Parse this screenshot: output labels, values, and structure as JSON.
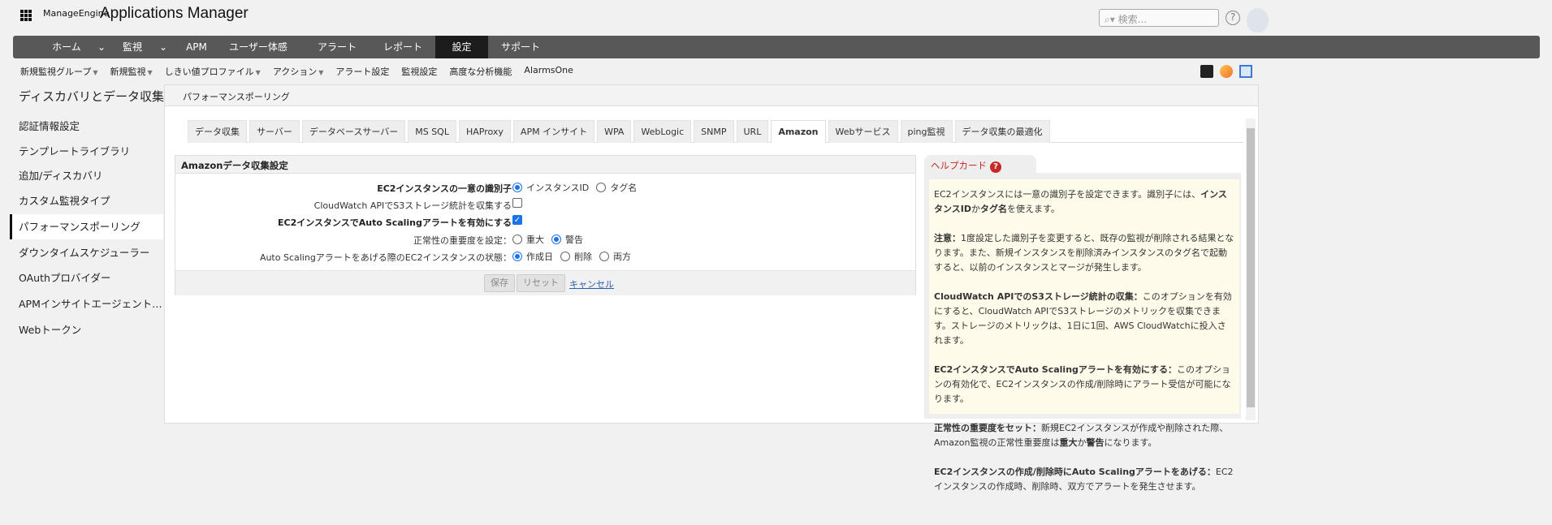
{
  "header": {
    "brand": "ManageEngine",
    "app_title": "Applications Manager",
    "search_placeholder": "検索...",
    "help": "?"
  },
  "nav": {
    "items": [
      {
        "label": "ホーム"
      },
      {
        "label": "監視"
      },
      {
        "label": "APM"
      },
      {
        "label": "ユーザー体感"
      },
      {
        "label": "アラート"
      },
      {
        "label": "レポート"
      },
      {
        "label": "設定",
        "active": true
      },
      {
        "label": "サポート"
      }
    ],
    "chevron": "⌄"
  },
  "subnav": [
    "新規監視グループ",
    "新規監視",
    "しきい値プロファイル",
    "アクション",
    "アラート設定",
    "監視設定",
    "高度な分析機能",
    "AlarmsOne"
  ],
  "sidebar": {
    "title": "ディスカバリとデータ収集",
    "items": [
      "認証情報設定",
      "テンプレートライブラリ",
      "追加/ディスカバリ",
      "カスタム監視タイプ",
      "パフォーマンスポーリング",
      "ダウンタイムスケジューラー",
      "OAuthプロバイダー",
      "APMインサイトエージェント設定...",
      "Webトークン"
    ],
    "active_index": 4
  },
  "main": {
    "title": "パフォーマンスポーリング",
    "tabs": [
      "データ収集",
      "サーバー",
      "データベースサーバー",
      "MS SQL",
      "HAProxy",
      "APM インサイト",
      "WPA",
      "WebLogic",
      "SNMP",
      "URL",
      "Amazon",
      "Webサービス",
      "ping監視",
      "データ収集の最適化"
    ],
    "active_tab": "Amazon",
    "form": {
      "title": "Amazonデータ収集設定",
      "rows": [
        {
          "label": "EC2インスタンスの一意の識別子",
          "options": [
            "インスタンスID",
            "タグ名"
          ],
          "selected": 0
        },
        {
          "label": "CloudWatch APIでS3ストレージ統計を収集する",
          "checked": false
        },
        {
          "label": "EC2インスタンスでAuto Scalingアラートを有効にする",
          "checked": true
        },
        {
          "label": "正常性の重要度を設定：",
          "options": [
            "重大",
            "警告"
          ],
          "selected": 1
        },
        {
          "label": "Auto Scalingアラートをあげる際のEC2インスタンスの状態：",
          "options": [
            "作成日",
            "削除",
            "両方"
          ],
          "selected": 0
        }
      ],
      "save": "保存",
      "reset": "リセット",
      "cancel": "キャンセル"
    },
    "help_card": {
      "title": "ヘルプカード",
      "q": "?",
      "p1a": "EC2インスタンスには一意の識別子を設定できます。識別子には、",
      "p1b": "インスタンスID",
      "p1c": "か",
      "p1d": "タグ名",
      "p1e": "を使えます。",
      "p2a": "注意：",
      "p2b": "1度設定した識別子を変更すると、既存の監視が削除される結果となります。また、新規インスタンスを削除済みインスタンスのタグ名で起動すると、以前のインスタンスとマージが発生します。",
      "p3a": "CloudWatch APIでのS3ストレージ統計の収集：",
      "p3b": "このオプションを有効にすると、CloudWatch APIでS3ストレージのメトリックを収集できます。ストレージのメトリックは、1日に1回、AWS CloudWatchに投入されます。",
      "p4a": "EC2インスタンスでAuto Scalingアラートを有効にする：",
      "p4b": "このオプションの有効化で、EC2インスタンスの作成/削除時にアラート受信が可能になります。",
      "p5a": "正常性の重要度をセット：",
      "p5b": "新規EC2インスタンスが作成や削除された際、Amazon監視の正常性重要度は",
      "p5c": "重大",
      "p5d": "か",
      "p5e": "警告",
      "p5f": "になります。",
      "p6a": "EC2インスタンスの作成/削除時にAuto Scalingアラートをあげる：",
      "p6b": "EC2インスタンスの作成時、削除時、双方でアラートを発生させます。"
    }
  }
}
